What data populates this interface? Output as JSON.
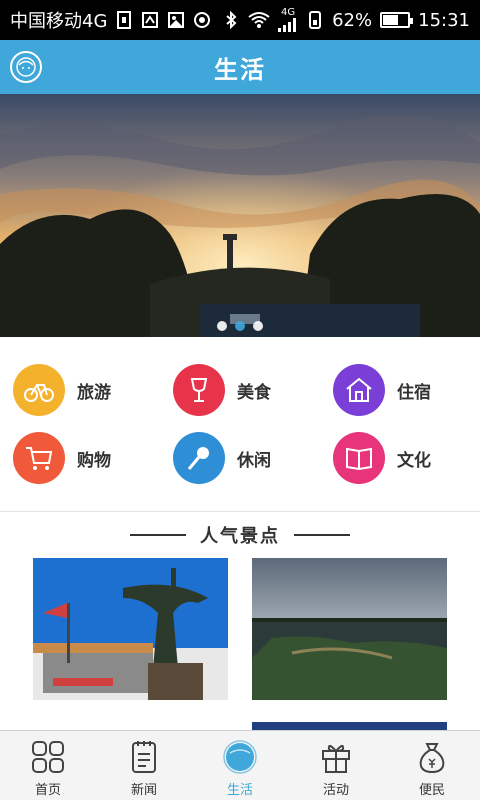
{
  "status_bar": {
    "carrier": "中国移动4G",
    "network": "4G",
    "battery_percent": "62%",
    "battery_level": 0.62,
    "time": "15:31"
  },
  "header": {
    "title": "生活",
    "avatar_icon": "user-avatar-icon"
  },
  "banner": {
    "slide_count": 3,
    "active_index": 1
  },
  "categories": [
    {
      "label": "旅游",
      "icon": "bicycle-icon",
      "color": "#f4b12c"
    },
    {
      "label": "美食",
      "icon": "wine-glass-icon",
      "color": "#e8344a"
    },
    {
      "label": "住宿",
      "icon": "house-icon",
      "color": "#7b3fd8"
    },
    {
      "label": "购物",
      "icon": "shopping-cart-icon",
      "color": "#f05a3a"
    },
    {
      "label": "休闲",
      "icon": "microphone-icon",
      "color": "#2f8fd6"
    },
    {
      "label": "文化",
      "icon": "book-icon",
      "color": "#e8347a"
    }
  ],
  "popular": {
    "title": "人气景点"
  },
  "bottom_nav": [
    {
      "label": "首页",
      "icon": "grid-home-icon",
      "active": false
    },
    {
      "label": "新闻",
      "icon": "news-notebook-icon",
      "active": false
    },
    {
      "label": "生活",
      "icon": "life-circle-icon",
      "active": true
    },
    {
      "label": "活动",
      "icon": "gift-box-icon",
      "active": false
    },
    {
      "label": "便民",
      "icon": "money-bag-icon",
      "active": false
    }
  ],
  "colors": {
    "accent": "#3fa7d9",
    "status_bar": "#000000"
  }
}
